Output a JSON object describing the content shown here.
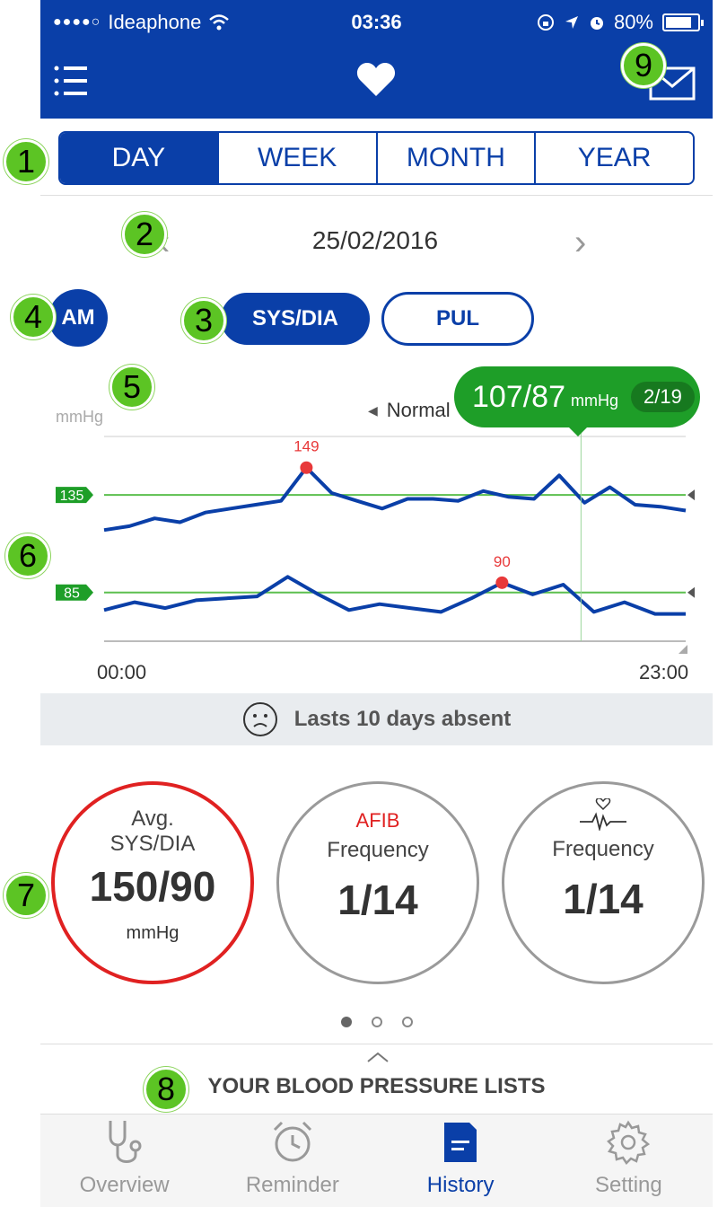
{
  "status_bar": {
    "signal": "●●●●○",
    "carrier": "Ideaphone",
    "time": "03:36",
    "battery": "80%"
  },
  "period_tabs": [
    {
      "label": "DAY",
      "active": true
    },
    {
      "label": "WEEK",
      "active": false
    },
    {
      "label": "MONTH",
      "active": false
    },
    {
      "label": "YEAR",
      "active": false
    }
  ],
  "date_nav": {
    "date": "25/02/2016",
    "prev": "‹",
    "next": "›"
  },
  "am_label": "AM",
  "mode_toggle": {
    "sys_dia": "SYS/DIA",
    "pul": "PUL"
  },
  "chart_header": {
    "unit": "mmHg",
    "legend": "Normal"
  },
  "tooltip": {
    "value": "107/87",
    "unit": "mmHg",
    "index": "2/19"
  },
  "chart_data": {
    "type": "line",
    "ylabel": "mmHg",
    "x_start_label": "00:00",
    "x_end_label": "23:00",
    "thresholds": [
      {
        "label": "135",
        "value": 135,
        "color": "#5cbf4e"
      },
      {
        "label": "85",
        "value": 85,
        "color": "#5cbf4e"
      }
    ],
    "ylim": [
      60,
      165
    ],
    "series": [
      {
        "values": [
          117,
          119,
          123,
          121,
          126,
          128,
          130,
          132,
          149,
          136,
          132,
          128,
          133,
          133,
          132,
          137,
          134,
          133,
          145,
          131,
          139,
          130,
          129,
          127
        ]
      },
      {
        "values": [
          76,
          80,
          77,
          81,
          82,
          83,
          93,
          84,
          76,
          79,
          77,
          75,
          82,
          90,
          84,
          89,
          75,
          80,
          74,
          74
        ]
      }
    ],
    "annotations": [
      {
        "series": 0,
        "index": 8,
        "label": "149",
        "color": "#e8393a"
      },
      {
        "series": 1,
        "index": 13,
        "label": "90",
        "color": "#e8393a"
      }
    ],
    "selected_fraction": 0.82
  },
  "absent_message": "Lasts 10 days absent",
  "cards": [
    {
      "line1": "Avg.",
      "line2": "SYS/DIA",
      "value": "150/90",
      "unit": "mmHg",
      "border": "#e02121"
    },
    {
      "tag": "AFIB",
      "line2": "Frequency",
      "value": "1/14",
      "border": "#9a9a9a"
    },
    {
      "line2": "Frequency",
      "value": "1/14",
      "border": "#9a9a9a"
    }
  ],
  "lists_title": "YOUR BLOOD PRESSURE LISTS",
  "tabbar": [
    {
      "label": "Overview",
      "active": false
    },
    {
      "label": "Reminder",
      "active": false
    },
    {
      "label": "History",
      "active": true
    },
    {
      "label": "Setting",
      "active": false
    }
  ],
  "badges": [
    "1",
    "2",
    "3",
    "4",
    "5",
    "6",
    "7",
    "8",
    "9"
  ],
  "colors": {
    "brand_blue": "#0a3fa8",
    "badge_green": "#5cc424",
    "tooltip_green": "#1e9e28",
    "alert_red": "#e02121"
  }
}
